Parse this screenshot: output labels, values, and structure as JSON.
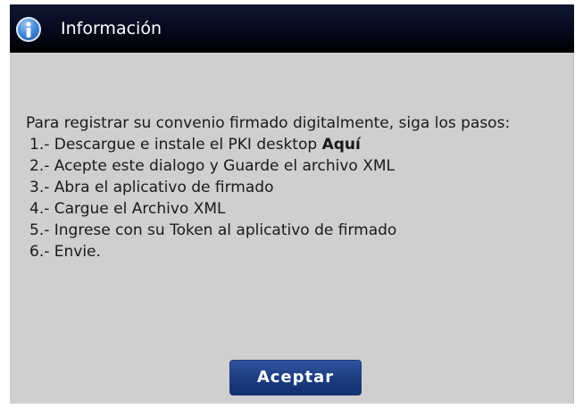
{
  "dialog": {
    "title": "Información",
    "intro": "Para registrar su convenio firmado digitalmente, siga los pasos:",
    "steps": [
      {
        "prefix": "1.- Descargue e instale el PKI desktop ",
        "link": "Aquí"
      },
      {
        "text": "2.- Acepte este dialogo y Guarde el archivo XML"
      },
      {
        "text": "3.- Abra el aplicativo de firmado"
      },
      {
        "text": "4.- Cargue el Archivo XML"
      },
      {
        "text": "5.- Ingrese con su Token al aplicativo de firmado"
      },
      {
        "text": "6.- Envie."
      }
    ],
    "accept_label": "Aceptar"
  },
  "icons": {
    "title_icon": "info-icon"
  },
  "colors": {
    "titlebar": "#050a1c",
    "body": "#cfcfcf",
    "button": "#1d3d82"
  }
}
